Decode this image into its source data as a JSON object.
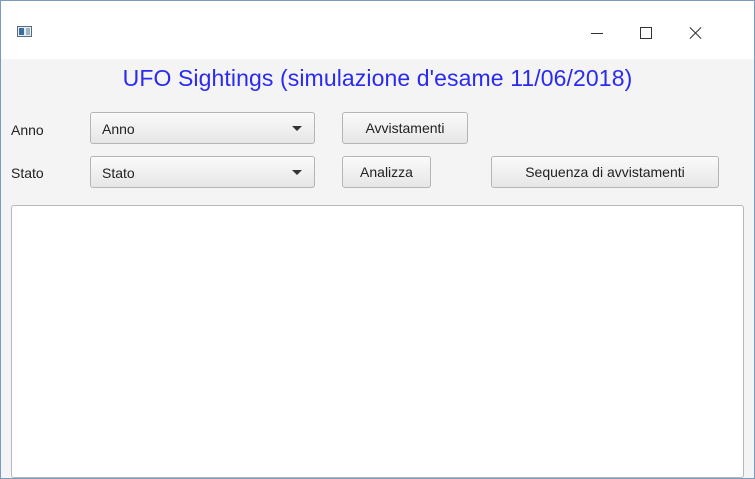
{
  "window": {
    "title": "",
    "controls": {
      "minimize_icon": "minimize-icon",
      "maximize_icon": "maximize-icon",
      "close_icon": "close-icon"
    }
  },
  "header": {
    "title": "UFO Sightings (simulazione d'esame 11/06/2018)",
    "title_color": "#2a2af0"
  },
  "row1": {
    "label": "Anno",
    "combo_value": "Anno",
    "button": "Avvistamenti"
  },
  "row2": {
    "label": "Stato",
    "combo_value": "Stato",
    "button_analizza": "Analizza",
    "button_sequenza": "Sequenza di avvistamenti"
  },
  "output": {
    "text": ""
  }
}
